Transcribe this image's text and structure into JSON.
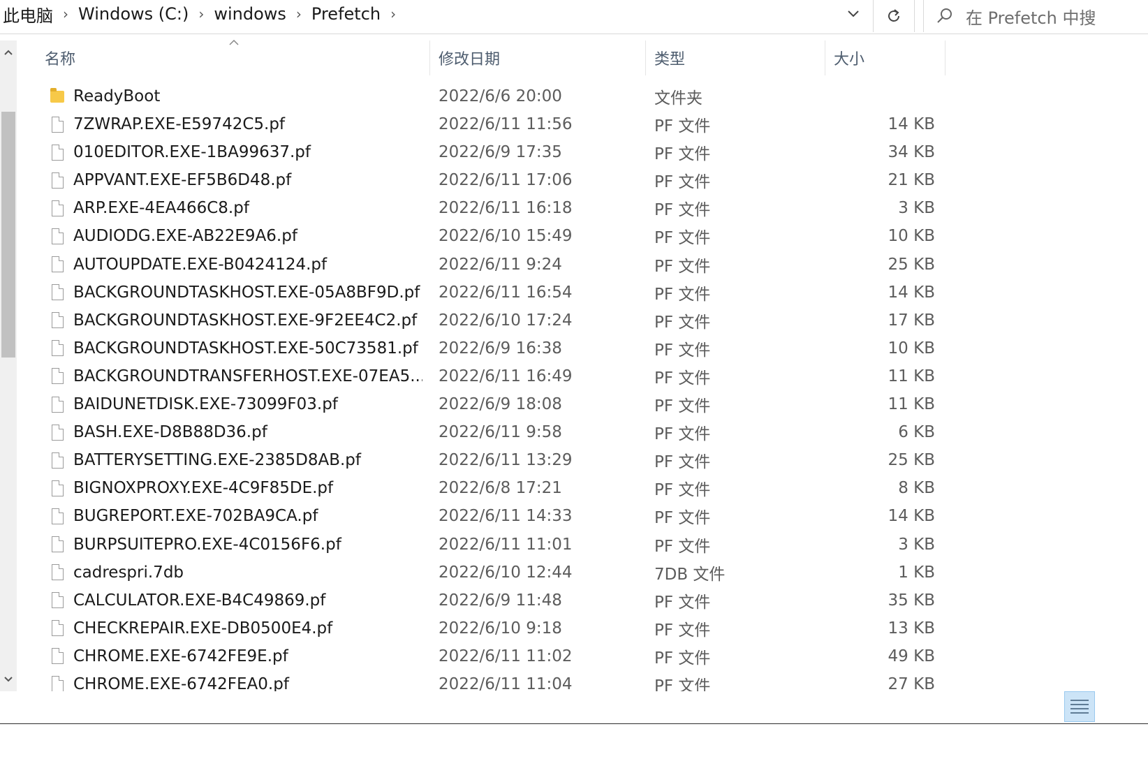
{
  "breadcrumb": {
    "items": [
      "此电脑",
      "Windows (C:)",
      "windows",
      "Prefetch"
    ],
    "separator": "›"
  },
  "address_bar": {
    "dropdown_icon": "chevron-down-icon",
    "refresh_icon": "refresh-icon"
  },
  "search": {
    "placeholder": "在 Prefetch 中搜",
    "icon": "search-icon"
  },
  "columns": {
    "name": "名称",
    "date": "修改日期",
    "type": "类型",
    "size": "大小"
  },
  "files": [
    {
      "icon": "folder-icon",
      "name": "ReadyBoot",
      "date": "2022/6/6 20:00",
      "type": "文件夹",
      "size": ""
    },
    {
      "icon": "file-icon",
      "name": "7ZWRAP.EXE-E59742C5.pf",
      "date": "2022/6/11 11:56",
      "type": "PF 文件",
      "size": "14 KB"
    },
    {
      "icon": "file-icon",
      "name": "010EDITOR.EXE-1BA99637.pf",
      "date": "2022/6/9 17:35",
      "type": "PF 文件",
      "size": "34 KB"
    },
    {
      "icon": "file-icon",
      "name": "APPVANT.EXE-EF5B6D48.pf",
      "date": "2022/6/11 17:06",
      "type": "PF 文件",
      "size": "21 KB"
    },
    {
      "icon": "file-icon",
      "name": "ARP.EXE-4EA466C8.pf",
      "date": "2022/6/11 16:18",
      "type": "PF 文件",
      "size": "3 KB"
    },
    {
      "icon": "file-icon",
      "name": "AUDIODG.EXE-AB22E9A6.pf",
      "date": "2022/6/10 15:49",
      "type": "PF 文件",
      "size": "10 KB"
    },
    {
      "icon": "file-icon",
      "name": "AUTOUPDATE.EXE-B0424124.pf",
      "date": "2022/6/11 9:24",
      "type": "PF 文件",
      "size": "25 KB"
    },
    {
      "icon": "file-icon",
      "name": "BACKGROUNDTASKHOST.EXE-05A8BF9D.pf",
      "date": "2022/6/11 16:54",
      "type": "PF 文件",
      "size": "14 KB"
    },
    {
      "icon": "file-icon",
      "name": "BACKGROUNDTASKHOST.EXE-9F2EE4C2.pf",
      "date": "2022/6/10 17:24",
      "type": "PF 文件",
      "size": "17 KB"
    },
    {
      "icon": "file-icon",
      "name": "BACKGROUNDTASKHOST.EXE-50C73581.pf",
      "date": "2022/6/9 16:38",
      "type": "PF 文件",
      "size": "10 KB"
    },
    {
      "icon": "file-icon",
      "name": "BACKGROUNDTRANSFERHOST.EXE-07EA5...",
      "date": "2022/6/11 16:49",
      "type": "PF 文件",
      "size": "11 KB"
    },
    {
      "icon": "file-icon",
      "name": "BAIDUNETDISK.EXE-73099F03.pf",
      "date": "2022/6/9 18:08",
      "type": "PF 文件",
      "size": "11 KB"
    },
    {
      "icon": "file-icon",
      "name": "BASH.EXE-D8B88D36.pf",
      "date": "2022/6/11 9:58",
      "type": "PF 文件",
      "size": "6 KB"
    },
    {
      "icon": "file-icon",
      "name": "BATTERYSETTING.EXE-2385D8AB.pf",
      "date": "2022/6/11 13:29",
      "type": "PF 文件",
      "size": "25 KB"
    },
    {
      "icon": "file-icon",
      "name": "BIGNOXPROXY.EXE-4C9F85DE.pf",
      "date": "2022/6/8 17:21",
      "type": "PF 文件",
      "size": "8 KB"
    },
    {
      "icon": "file-icon",
      "name": "BUGREPORT.EXE-702BA9CA.pf",
      "date": "2022/6/11 14:33",
      "type": "PF 文件",
      "size": "14 KB"
    },
    {
      "icon": "file-icon",
      "name": "BURPSUITEPRO.EXE-4C0156F6.pf",
      "date": "2022/6/11 11:01",
      "type": "PF 文件",
      "size": "3 KB"
    },
    {
      "icon": "file-icon",
      "name": "cadrespri.7db",
      "date": "2022/6/10 12:44",
      "type": "7DB 文件",
      "size": "1 KB"
    },
    {
      "icon": "file-icon",
      "name": "CALCULATOR.EXE-B4C49869.pf",
      "date": "2022/6/9 11:48",
      "type": "PF 文件",
      "size": "35 KB"
    },
    {
      "icon": "file-icon",
      "name": "CHECKREPAIR.EXE-DB0500E4.pf",
      "date": "2022/6/10 9:18",
      "type": "PF 文件",
      "size": "13 KB"
    },
    {
      "icon": "file-icon",
      "name": "CHROME.EXE-6742FE9E.pf",
      "date": "2022/6/11 11:02",
      "type": "PF 文件",
      "size": "49 KB"
    },
    {
      "icon": "file-icon",
      "name": "CHROME.EXE-6742FEA0.pf",
      "date": "2022/6/11 11:04",
      "type": "PF 文件",
      "size": "27 KB"
    }
  ],
  "status_bar": {
    "details_view_icon": "details-view-icon"
  }
}
